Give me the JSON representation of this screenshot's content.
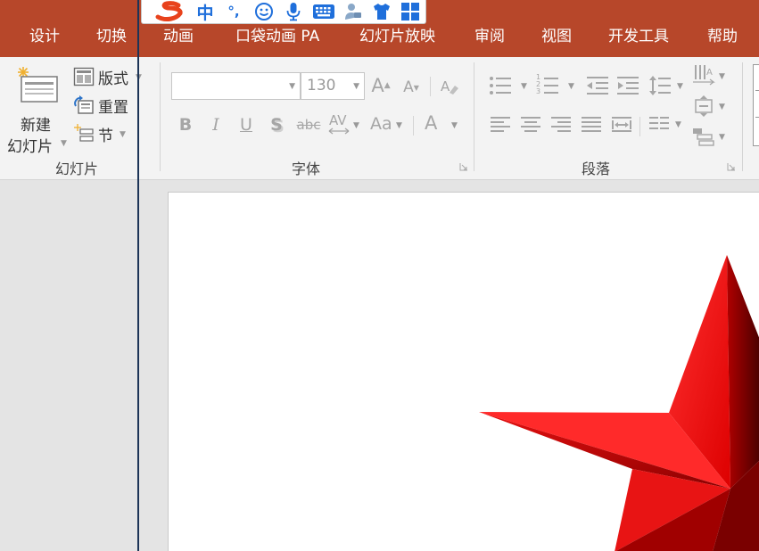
{
  "tabs": [
    {
      "label": "设计"
    },
    {
      "label": "切换"
    },
    {
      "label": "动画"
    },
    {
      "label": "口袋动画 PA"
    },
    {
      "label": "幻灯片放映"
    },
    {
      "label": "审阅"
    },
    {
      "label": "视图"
    },
    {
      "label": "开发工具"
    },
    {
      "label": "帮助"
    }
  ],
  "ime_toolbar": {
    "mode_label": "中",
    "punct_label": "°,",
    "icons": [
      "sogou-logo-icon",
      "smiley-icon",
      "microphone-icon",
      "keyboard-icon",
      "person-icon",
      "tshirt-icon",
      "grid-icon"
    ]
  },
  "groups": {
    "slides": {
      "label": "幻灯片",
      "new_slide_line1": "新建",
      "new_slide_line2": "幻灯片",
      "layout": "版式",
      "reset": "重置",
      "section": "节"
    },
    "font": {
      "label": "字体",
      "font_name": "",
      "font_size": "130",
      "increase": "A",
      "decrease": "A",
      "bold": "B",
      "italic": "I",
      "underline": "U",
      "shadow": "S",
      "strike": "abc",
      "spacing": "AV",
      "case": "Aa",
      "color": "A"
    },
    "paragraph": {
      "label": "段落",
      "numbering": [
        "1",
        "2",
        "3"
      ]
    }
  },
  "colors": {
    "tab_bar": "#b7472a",
    "ribbon": "#f3f3f3",
    "workspace": "#e4e4e4",
    "star_light": "#ff2222",
    "star_dark": "#6e0000"
  }
}
